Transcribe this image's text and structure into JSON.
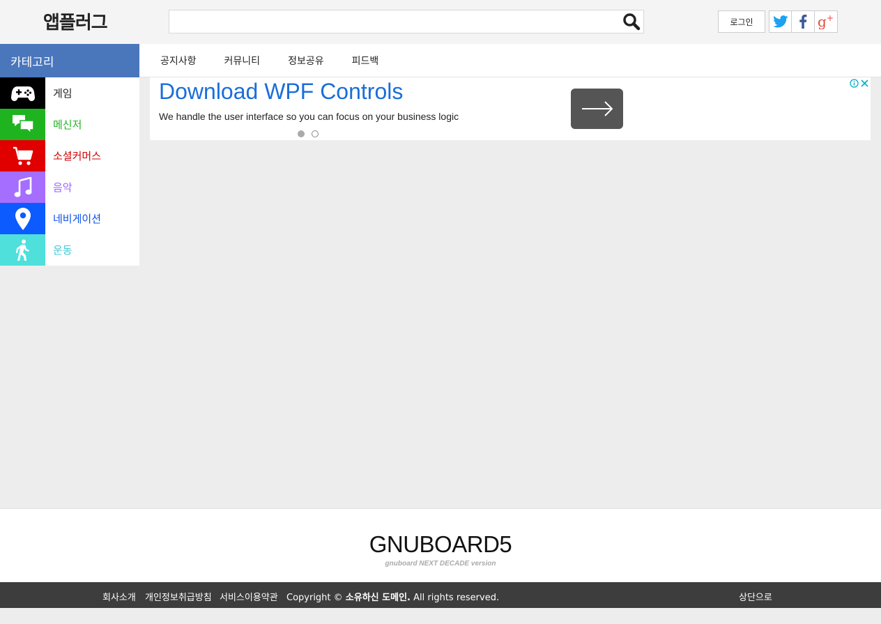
{
  "header": {
    "logo": "앱플러그",
    "search": {
      "value": "",
      "placeholder": ""
    },
    "login_label": "로그인",
    "social": [
      {
        "name": "twitter",
        "icon": "twitter-icon",
        "color": "#1da1f2"
      },
      {
        "name": "facebook",
        "icon": "facebook-icon",
        "color": "#3b5998"
      },
      {
        "name": "google-plus",
        "icon": "google-plus-icon",
        "color": "#dd4b39"
      }
    ]
  },
  "sidebar": {
    "title": "카테고리",
    "items": [
      {
        "label": "게임",
        "icon": "gamepad-icon",
        "bg": "#000000",
        "color": "#222222"
      },
      {
        "label": "메신저",
        "icon": "chat-icon",
        "bg": "#1fb41f",
        "color": "#1fb41f"
      },
      {
        "label": "소셜커머스",
        "icon": "cart-icon",
        "bg": "#e10000",
        "color": "#d00000"
      },
      {
        "label": "음악",
        "icon": "music-note-icon",
        "bg": "#a56eff",
        "color": "#9a5fff"
      },
      {
        "label": "네비게이션",
        "icon": "map-pin-icon",
        "bg": "#0b5bff",
        "color": "#0b50e8"
      },
      {
        "label": "운동",
        "icon": "walking-person-icon",
        "bg": "#4fe0dc",
        "color": "#3ec9d6"
      }
    ]
  },
  "topnav": {
    "items": [
      "공지사항",
      "커뮤니티",
      "정보공유",
      "피드백"
    ]
  },
  "ad": {
    "title": "Download WPF Controls",
    "description": "We handle the user interface so you can focus on your business logic",
    "title_color": "#1a6ed8"
  },
  "footer": {
    "logo": "GNUBOARD5",
    "tagline": "gnuboard NEXT DECADE version",
    "links": [
      "회사소개",
      "개인정보취급방침",
      "서비스이용약관"
    ],
    "copyright_prefix": "Copyright ©",
    "copyright_owner": "소유하신 도메인.",
    "copyright_suffix": "All rights reserved.",
    "totop_label": "상단으로"
  }
}
